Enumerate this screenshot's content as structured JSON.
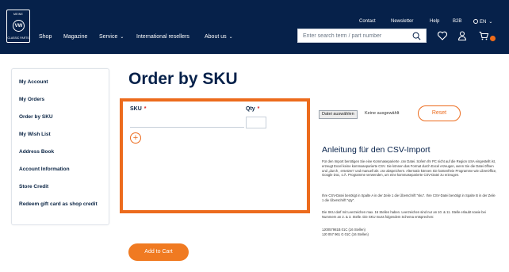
{
  "header": {
    "logo": {
      "brand_text": "MEINE",
      "badge_text": "VW",
      "sub_text": "CLASSIC PARTS"
    },
    "topnav": [
      "Contact",
      "Newsletter",
      "Help",
      "B2B",
      "EN"
    ],
    "mainnav": {
      "shop": "Shop",
      "magazine": "Magazine",
      "service": "Service",
      "resellers": "International resellers",
      "about": "About us"
    },
    "search_placeholder": "Enter search term / part number"
  },
  "sidebar": {
    "items": [
      "My Account",
      "My Orders",
      "Order by SKU",
      "My Wish List",
      "Address Book",
      "Account Information",
      "Store Credit",
      "Redeem gift card as shop credit"
    ]
  },
  "main": {
    "title": "Order by SKU",
    "sku_label": "SKU",
    "qty_label": "Qty",
    "required_mark": "*",
    "add_row_symbol": "+",
    "file_button": "Datei auswählen",
    "file_status": "Keine ausgewählt",
    "reset_label": "Reset",
    "add_to_cart_label": "Add to Cart"
  },
  "csv": {
    "title": "Anleitung für den CSV-Import",
    "paragraphs": [
      "Für den Import benötigen Sie eine Kommaseparierte .csv Datei. Sofern Ihr PC nicht auf die Region USA eingestellt ist, erzeugt Excel keine kommaseparierte CSV. Sie können das Format durch Excel erzeugen, wenn Sie die Datei öffnen und „durch , ersetzen“ und manuell als .csv abspeichern. Alternativ können Sie kostenfreie Programme wie LibreOffice, Google Doc, o.Ä. Programme verwenden, um eine kommaseparierte CSV-Datei zu erzeugen.",
      "Ihre CSV-Datei benötigt in Spalte A in der Zeile 1 die Überschrift \"sku\". Ihre CSV-Datei benötigt in Spalte B in der Zeile 1 die Überschrift \"qty\".",
      "Die SKU darf mit Leerzeichen max. 16 Stellen haben. Leerzeichen sind nur an 10. & 11. Stelle erlaubt sowie bei Nummern an 2. & 3. Stelle. Die SKU muss folgendem Schema entsprechen:",
      "1J0057981B 01C (16 Stellen)",
      "1J0 057 961 G 01C (16 Stellen)"
    ]
  },
  "colors": {
    "header_bg": "#06214a",
    "accent": "#ec6b1d",
    "text": "#0a2444"
  }
}
